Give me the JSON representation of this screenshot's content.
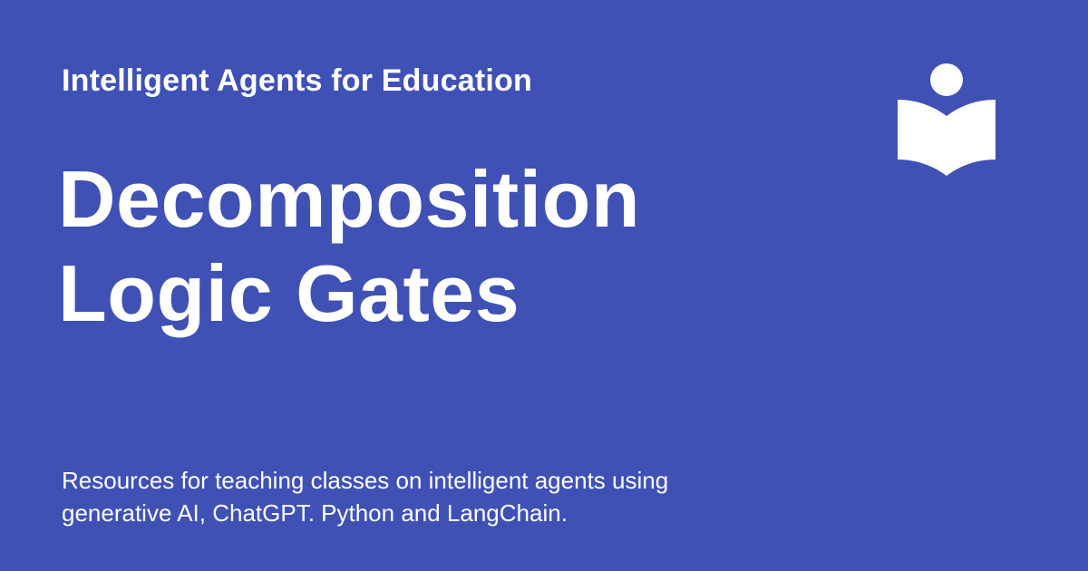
{
  "colors": {
    "background": "#3f51b5",
    "text": "#ffffff"
  },
  "header": {
    "site_name": "Intelligent Agents for Education",
    "logo_icon": "book-reader-icon"
  },
  "title": {
    "line1": "Decomposition",
    "line2": "Logic Gates"
  },
  "description": {
    "line1": "Resources for teaching classes on intelligent agents using",
    "line2": "generative AI, ChatGPT. Python and LangChain."
  }
}
